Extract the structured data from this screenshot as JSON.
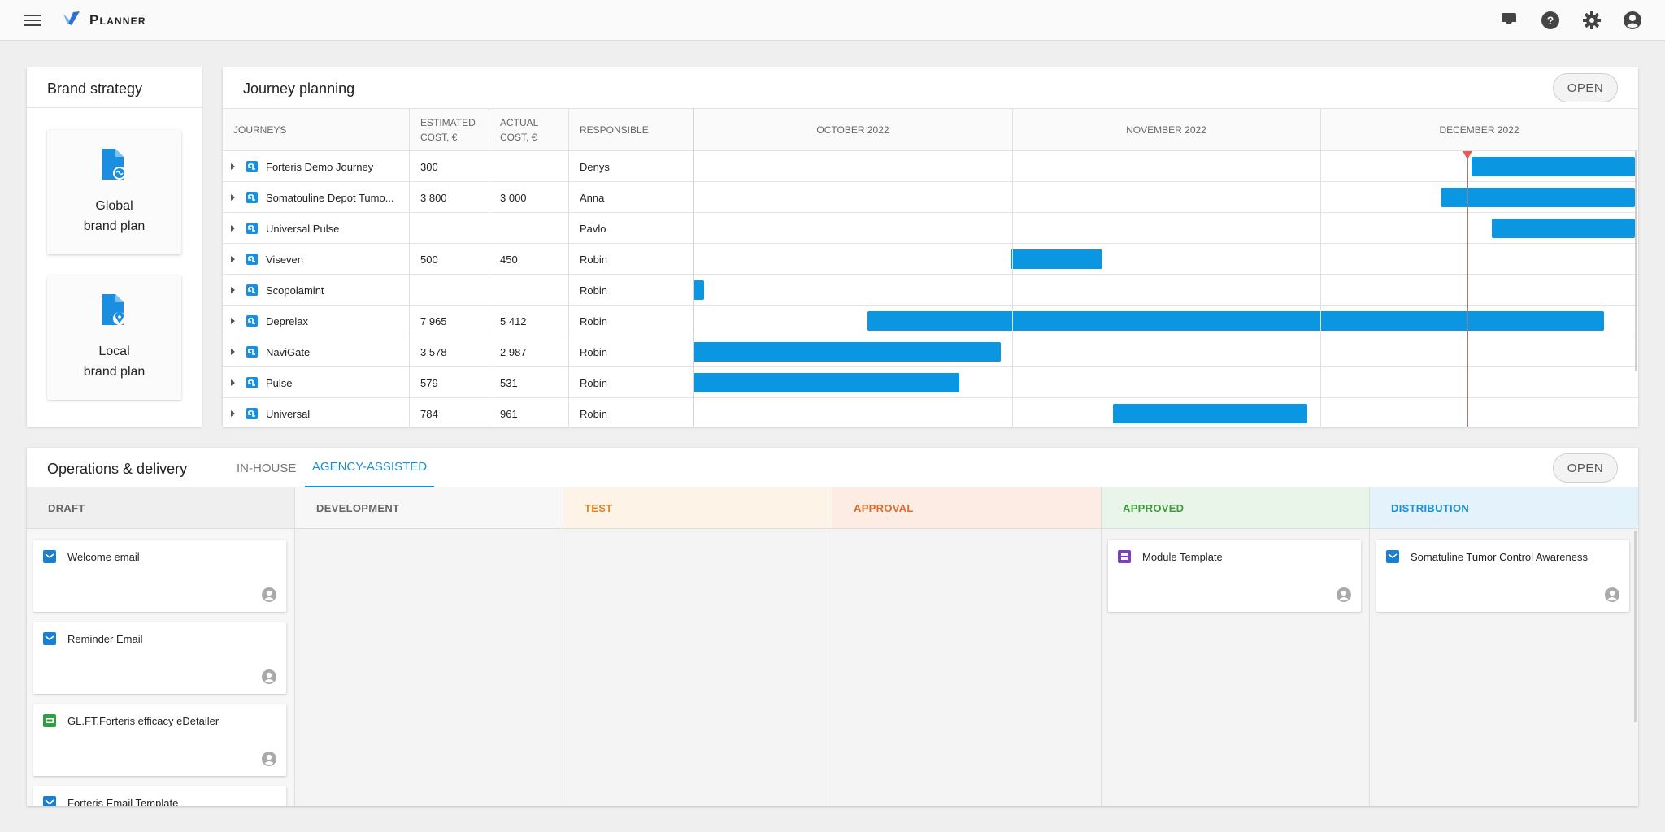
{
  "app": {
    "name": "Planner",
    "brand_color": "#2f6fd8"
  },
  "topbar": {
    "icons": [
      "menu-icon",
      "inbox-icon",
      "help-icon",
      "settings-icon",
      "account-icon"
    ]
  },
  "brand_strategy": {
    "title": "Brand strategy",
    "cards": [
      {
        "line1": "Global",
        "line2": "brand plan",
        "icon": "document-globe-icon"
      },
      {
        "line1": "Local",
        "line2": "brand plan",
        "icon": "document-pin-icon"
      }
    ]
  },
  "journey": {
    "title": "Journey planning",
    "open_label": "OPEN",
    "columns": {
      "journeys": "JOURNEYS",
      "est1": "ESTIMATED",
      "est2": "COST, €",
      "act1": "ACTUAL",
      "act2": "COST, €",
      "responsible": "RESPONSIBLE"
    },
    "months": [
      "OCTOBER 2022",
      "NOVEMBER 2022",
      "DECEMBER 2022"
    ],
    "today_marker": {
      "date": "2022-12-17"
    },
    "rows": [
      {
        "name": "Forteris Demo Journey",
        "est": "300",
        "act": "",
        "responsible": "Denys",
        "start": "2022-12-16",
        "end": "2022-12-31+"
      },
      {
        "name": "Somatouline Depot Tumo...",
        "est": "3 800",
        "act": "3 000",
        "responsible": "Anna",
        "start": "2022-12-13",
        "end": "2022-12-31+"
      },
      {
        "name": "Universal Pulse",
        "est": "",
        "act": "",
        "responsible": "Pavlo",
        "start": "2022-12-18",
        "end": "2022-12-31+"
      },
      {
        "name": "Viseven",
        "est": "500",
        "act": "450",
        "responsible": "Robin",
        "start": "2022-11-01",
        "end": "2022-11-10"
      },
      {
        "name": "Scopolamint",
        "est": "",
        "act": "",
        "responsible": "Robin",
        "start": "2022-10-01",
        "end": "2022-10-02"
      },
      {
        "name": "Deprelax",
        "est": "7 965",
        "act": "5 412",
        "responsible": "Robin",
        "start": "2022-10-18",
        "end": "2022-12-29"
      },
      {
        "name": "NaviGate",
        "est": "3 578",
        "act": "2 987",
        "responsible": "Robin",
        "start": "2022-10-01",
        "end": "2022-10-31"
      },
      {
        "name": "Pulse",
        "est": "579",
        "act": "531",
        "responsible": "Robin",
        "start": "2022-10-01",
        "end": "2022-10-27"
      },
      {
        "name": "Universal",
        "est": "784",
        "act": "961",
        "responsible": "Robin",
        "start": "2022-11-11",
        "end": "2022-11-30"
      }
    ]
  },
  "operations": {
    "title": "Operations & delivery",
    "tabs": [
      {
        "label": "IN-HOUSE",
        "active": false
      },
      {
        "label": "AGENCY-ASSISTED",
        "active": true
      }
    ],
    "open_label": "OPEN",
    "columns": [
      {
        "label": "DRAFT",
        "color": "#666666",
        "bg": "#efefef",
        "cards": [
          {
            "title": "Welcome email",
            "type": "email",
            "color": "#1a7fd1"
          },
          {
            "title": "Reminder Email",
            "type": "email",
            "color": "#1a7fd1"
          },
          {
            "title": "GL.FT.Forteris efficacy eDetailer",
            "type": "edetailer",
            "color": "#2e9e3e"
          },
          {
            "title": "Forteris Email Template",
            "type": "email",
            "color": "#1a7fd1"
          }
        ]
      },
      {
        "label": "DEVELOPMENT",
        "color": "#666666",
        "bg": "#f7f7f7",
        "cards": []
      },
      {
        "label": "TEST",
        "color": "#e0842a",
        "bg": "#fdf3e7",
        "cards": []
      },
      {
        "label": "APPROVAL",
        "color": "#e06a2a",
        "bg": "#fcece3",
        "cards": []
      },
      {
        "label": "APPROVED",
        "color": "#3f9a3a",
        "bg": "#eaf5ea",
        "cards": [
          {
            "title": "Module Template",
            "type": "module",
            "color": "#7b3fc4"
          }
        ]
      },
      {
        "label": "DISTRIBUTION",
        "color": "#1a8fd6",
        "bg": "#e4f2fb",
        "cards": [
          {
            "title": "Somatuline Tumor Control Awareness",
            "type": "email",
            "color": "#1a7fd1"
          }
        ]
      }
    ]
  }
}
